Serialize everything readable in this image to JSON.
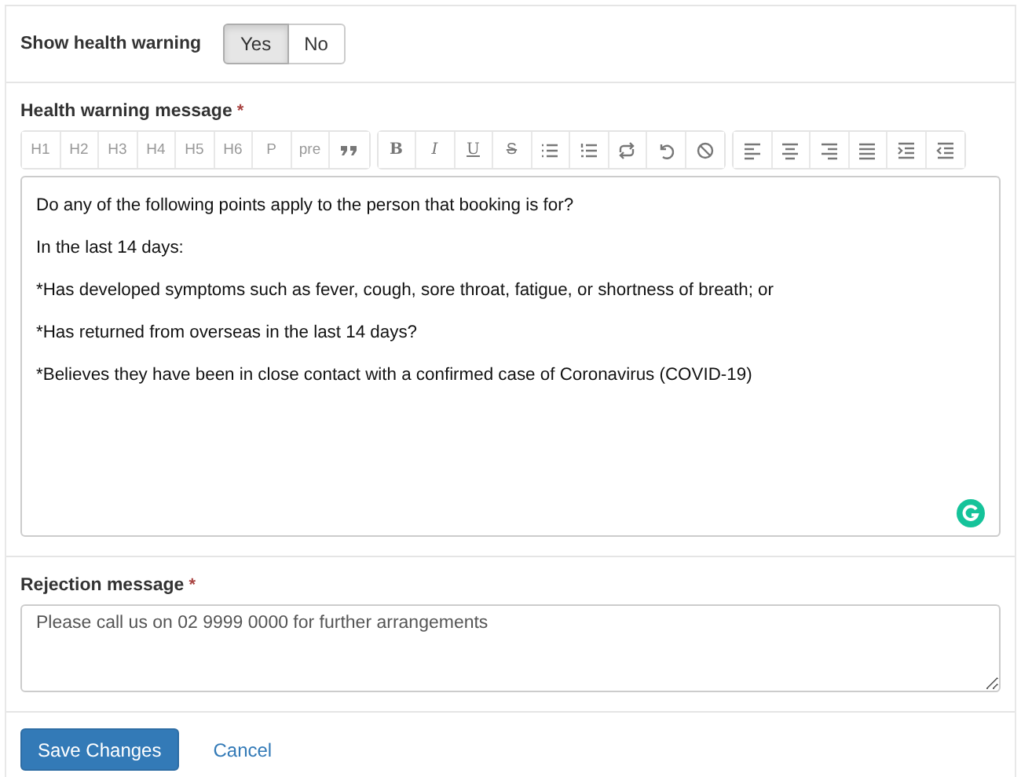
{
  "health_warning_toggle": {
    "label": "Show health warning",
    "options": [
      {
        "label": "Yes",
        "selected": true
      },
      {
        "label": "No",
        "selected": false
      }
    ]
  },
  "health_warning_message": {
    "label": "Health warning message",
    "required_mark": "*",
    "toolbar": [
      [
        {
          "kind": "text",
          "label": "H1"
        },
        {
          "kind": "text",
          "label": "H2"
        },
        {
          "kind": "text",
          "label": "H3"
        },
        {
          "kind": "text",
          "label": "H4"
        },
        {
          "kind": "text",
          "label": "H5"
        },
        {
          "kind": "text",
          "label": "H6"
        },
        {
          "kind": "text",
          "label": "P"
        },
        {
          "kind": "text",
          "label": "pre"
        },
        {
          "kind": "icon"
        }
      ],
      [
        {
          "kind": "bold",
          "label": "B"
        },
        {
          "kind": "italic",
          "label": "I"
        },
        {
          "kind": "underline",
          "label": "U"
        },
        {
          "kind": "strike",
          "label": "S"
        },
        {
          "kind": "icon"
        },
        {
          "kind": "icon"
        },
        {
          "kind": "icon"
        },
        {
          "kind": "icon"
        },
        {
          "kind": "icon"
        }
      ],
      [
        {
          "kind": "icon"
        },
        {
          "kind": "icon"
        },
        {
          "kind": "icon"
        },
        {
          "kind": "icon"
        },
        {
          "kind": "icon"
        },
        {
          "kind": "icon"
        }
      ]
    ],
    "paragraphs": [
      "Do any of the following points apply to the person that booking is for?",
      "In the last 14 days:",
      "*Has developed symptoms such as fever, cough, sore throat, fatigue, or shortness of breath; or",
      "*Has returned from overseas in the last 14 days?",
      "*Believes they have been in close contact with a confirmed case of Coronavirus (COVID-19)"
    ]
  },
  "rejection_message": {
    "label": "Rejection message",
    "required_mark": "*",
    "value": "Please call us on 02 9999 0000 for further arrangements"
  },
  "buttons": {
    "save": "Save Changes",
    "cancel": "Cancel"
  }
}
